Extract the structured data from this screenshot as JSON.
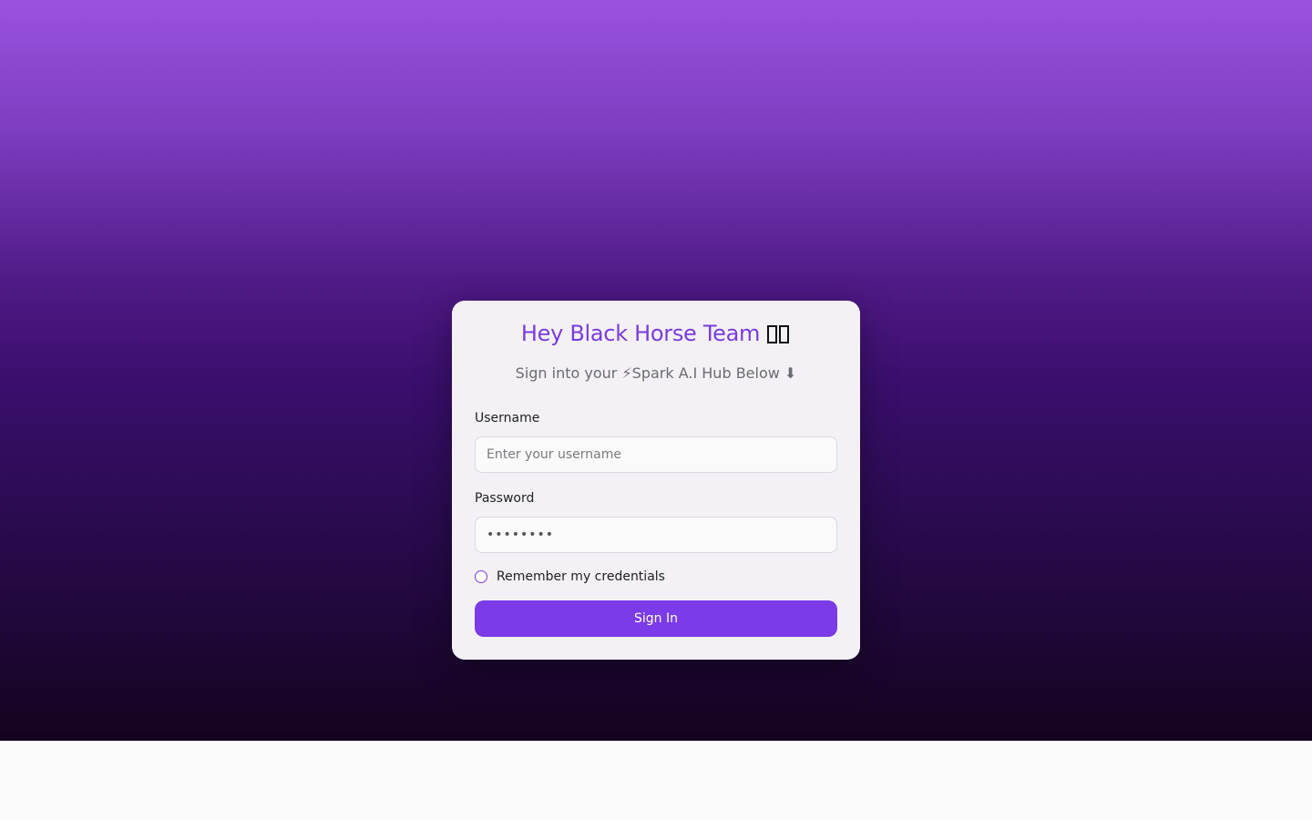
{
  "login": {
    "title": "Hey Black Horse Team",
    "subtitle": "Sign into your ⚡Spark A.I Hub Below ⬇",
    "username_label": "Username",
    "username_placeholder": "Enter your username",
    "password_label": "Password",
    "password_value": "••••••••",
    "remember_label": "Remember my credentials",
    "remember_checked": false,
    "submit_label": "Sign In"
  },
  "colors": {
    "accent": "#7b3be8",
    "title": "#7b3be0",
    "gradient_top": "#9b52e0",
    "gradient_bottom": "#14031f"
  },
  "icons": {
    "title_emoji": "unrendered-emoji-boxes-icon"
  }
}
